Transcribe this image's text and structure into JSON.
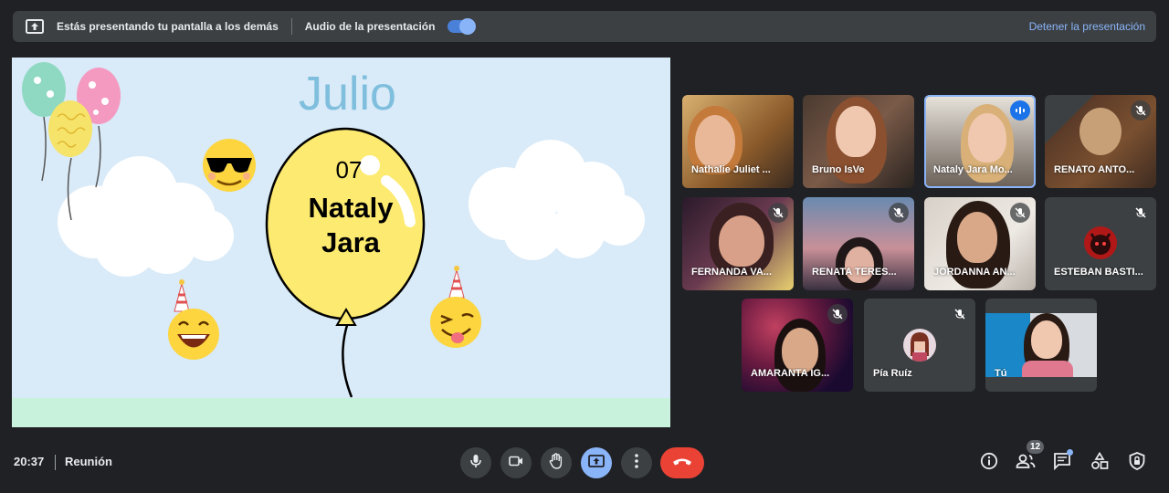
{
  "present_bar": {
    "presenting_text": "Estás presentando tu pantalla a los demás",
    "audio_label": "Audio de la presentación",
    "audio_enabled": true,
    "stop_label": "Detener la presentación"
  },
  "slide": {
    "title": "Julio",
    "day": "07",
    "name_line1": "Nataly",
    "name_line2": "Jara"
  },
  "participants": [
    {
      "name": "Nathalie Juliet ...",
      "muted": false
    },
    {
      "name": "Bruno IsVe",
      "muted": false
    },
    {
      "name": "Nataly Jara Mo...",
      "muted": false,
      "speaking": true
    },
    {
      "name": "RENATO ANTO...",
      "muted": true
    },
    {
      "name": "FERNANDA VA...",
      "muted": true
    },
    {
      "name": "RENATA TERES...",
      "muted": true
    },
    {
      "name": "JORDANNA AN...",
      "muted": true
    },
    {
      "name": "ESTEBAN BASTI...",
      "muted": true
    },
    {
      "name": "AMARANTA IG...",
      "muted": true
    },
    {
      "name": "Pía Ruíz",
      "muted": true
    },
    {
      "name": "Tú",
      "muted": false
    }
  ],
  "bottom_bar": {
    "time": "20:37",
    "meeting_label": "Reunión",
    "people_count": "12"
  },
  "icons": [
    "present-screen-icon",
    "microphone-icon",
    "camera-icon",
    "raise-hand-icon",
    "present-now-icon",
    "more-options-icon",
    "hang-up-icon",
    "info-icon",
    "people-icon",
    "chat-icon",
    "activities-icon",
    "host-controls-icon",
    "mic-off-icon",
    "speaking-icon"
  ],
  "colors": {
    "accent": "#8ab4f8",
    "hangup": "#ea4335",
    "background": "#202124",
    "toggle": "#4a80d8"
  }
}
